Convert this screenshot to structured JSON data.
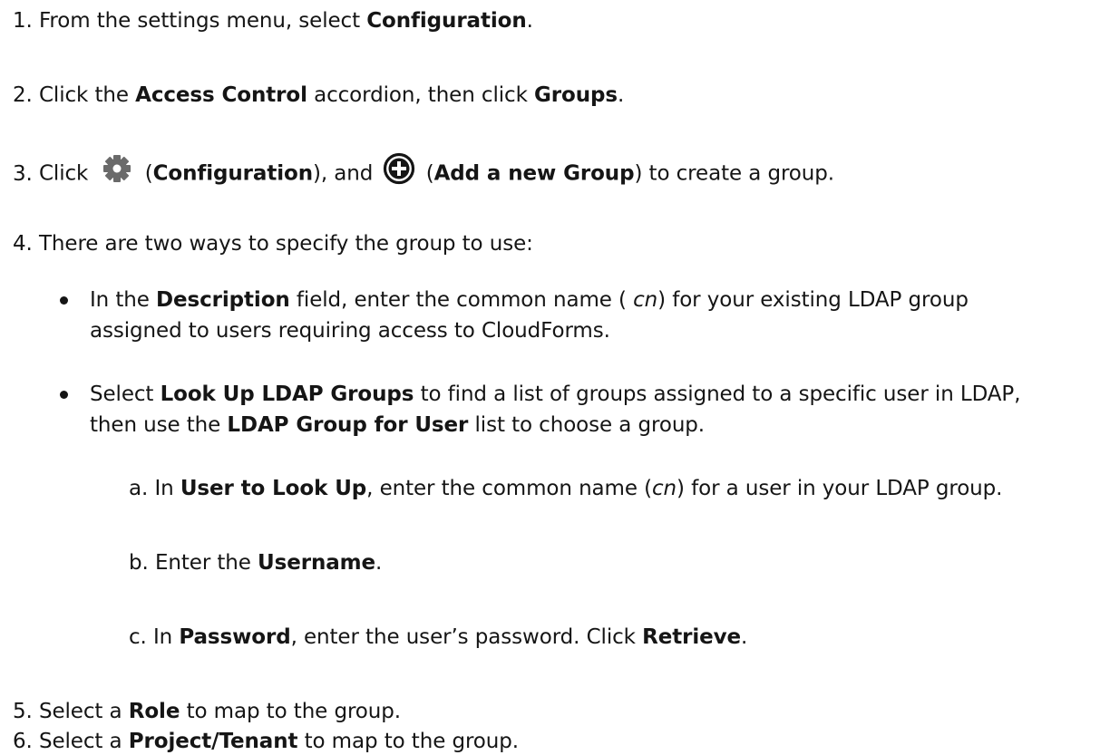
{
  "steps": [
    {
      "num": "1.",
      "t0": "From the settings menu, select ",
      "b0": "Configuration",
      "t1": "."
    },
    {
      "num": "2.",
      "t0": "Click the ",
      "b0": "Access Control",
      "t1": " accordion, then click ",
      "b1": "Groups",
      "t2": "."
    },
    {
      "num": "3.",
      "t0": "Click ",
      "t1": " (",
      "b0": "Configuration",
      "t2": "), and ",
      "t3": " (",
      "b1": "Add a new Group",
      "t4": ") to create a group."
    },
    {
      "num": "4.",
      "t0": "There are two ways to specify the group to use:"
    },
    {
      "num": "5.",
      "t0": "Select a ",
      "b0": "Role",
      "t1": " to map to the group."
    },
    {
      "num": "6.",
      "t0": "Select a ",
      "b0": "Project/Tenant",
      "t1": " to map to the group."
    }
  ],
  "bullets": [
    {
      "l1_t0": "In the ",
      "l1_b0": "Description",
      "l1_t1": " field, enter the common name (",
      "l1_i0": " cn",
      "l1_t2": ") for your existing LDAP group",
      "l2_t0": "assigned to users requiring access to CloudForms."
    },
    {
      "l1_t0": "Select ",
      "l1_b0": "Look Up LDAP Groups",
      "l1_t1": " to find a list of groups assigned to a specific user in LDAP,",
      "l2_t0": "then use the ",
      "l2_b0": "LDAP Group for User",
      "l2_t1": " list to choose a group."
    }
  ],
  "substeps": [
    {
      "num": "a.",
      "t0": "In ",
      "b0": "User to Look Up",
      "t1": ", enter the common name (",
      "i0": "cn",
      "t2": ") for a user in your LDAP group."
    },
    {
      "num": "b.",
      "t0": "Enter the ",
      "b0": "Username",
      "t1": "."
    },
    {
      "num": "c.",
      "t0": "In ",
      "b0": "Password",
      "t1": ", enter the user’s password. Click ",
      "b1": "Retrieve",
      "t2": "."
    }
  ],
  "icons": {
    "gear": "gear-icon",
    "plus": "add-circle-icon",
    "gear_color": "#6a6a6a",
    "plus_color": "#151515"
  }
}
